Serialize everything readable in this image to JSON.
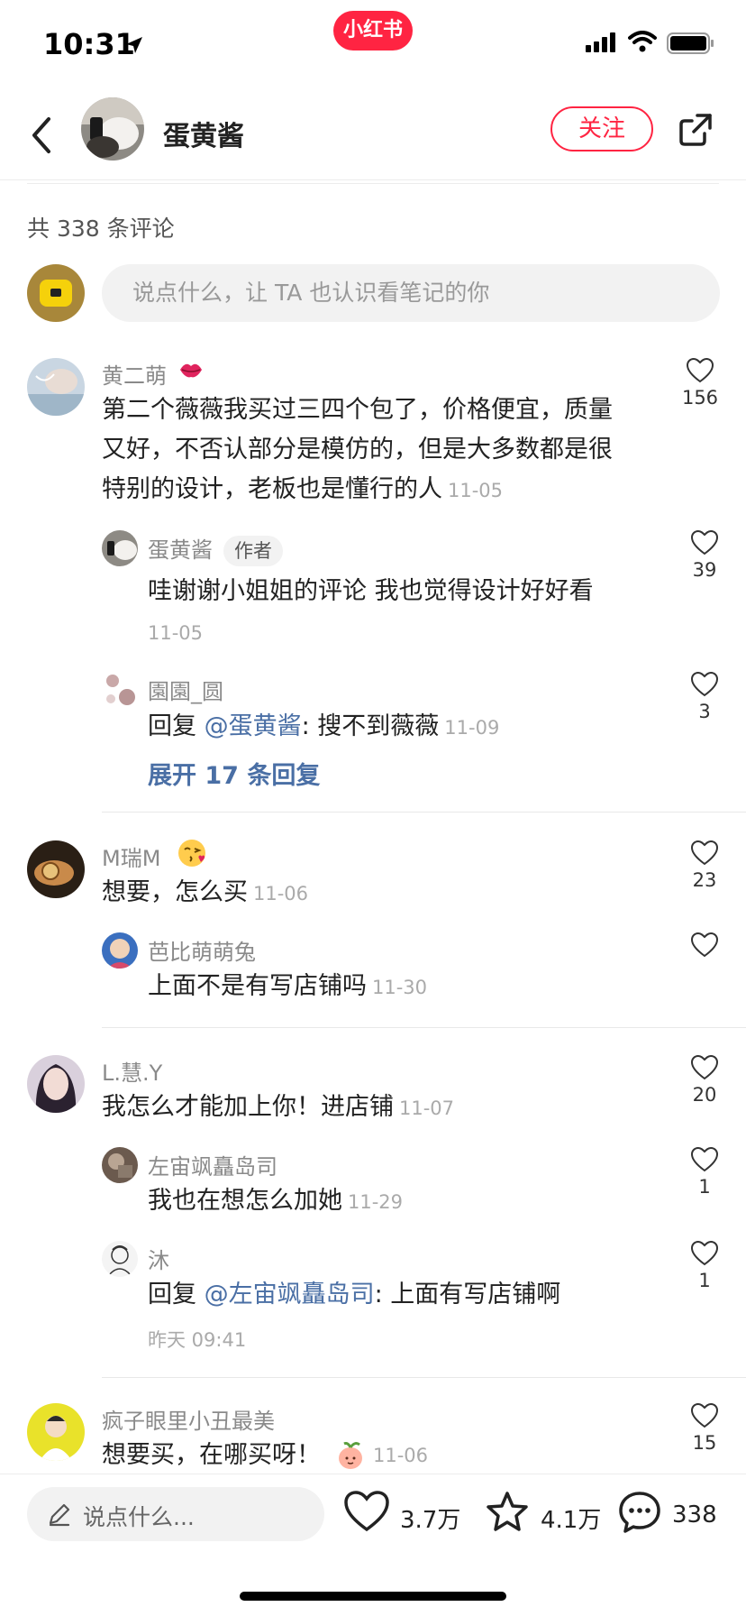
{
  "status_bar": {
    "time": "10:31",
    "app_badge": "小红书"
  },
  "header": {
    "author_name": "蛋黄酱",
    "follow_label": "关注"
  },
  "comments_summary": {
    "total": "共 338 条评论"
  },
  "input": {
    "placeholder": "说点什么，让 TA 也认识看笔记的你"
  },
  "comments": [
    {
      "user": "黄二萌",
      "text_lines": [
        "第二个薇薇我买过三四个包了，价格便宜，质量",
        "又好，不否认部分是模仿的，但是大多数都是很",
        "特别的设计，老板也是懂行的人"
      ],
      "date": "11-05",
      "likes": "156",
      "replies": [
        {
          "user": "蛋黄酱",
          "tag": "作者",
          "text": "哇谢谢小姐姐的评论 我也觉得设计好好看",
          "date": "11-05",
          "likes": "39"
        },
        {
          "user": "園園_圆",
          "prefix": "回复 ",
          "mention": "@蛋黄酱",
          "text": ": 搜不到薇薇",
          "date": "11-09",
          "likes": "3"
        }
      ],
      "expand_label": "展开 17 条回复"
    },
    {
      "user": "M瑞M",
      "text": "想要，怎么买",
      "date": "11-06",
      "likes": "23",
      "replies": [
        {
          "user": "芭比萌萌兔",
          "text": "上面不是有写店铺吗",
          "date": "11-30",
          "likes": ""
        }
      ]
    },
    {
      "user": "L.慧.Y",
      "text": "我怎么才能加上你！进店铺",
      "date": "11-07",
      "likes": "20",
      "replies": [
        {
          "user": "左宙飒矗岛司",
          "text": "我也在想怎么加她",
          "date": "11-29",
          "likes": "1"
        },
        {
          "user": "沐",
          "prefix": "回复 ",
          "mention": "@左宙飒矗岛司",
          "text": ": 上面有写店铺啊",
          "date": "昨天 09:41",
          "likes": "1"
        }
      ]
    },
    {
      "user": "疯子眼里小丑最美",
      "text": "想要买，在哪买呀！",
      "date": "11-06",
      "likes": "15"
    }
  ],
  "bottom_bar": {
    "input_placeholder": "说点什么...",
    "likes": "3.7万",
    "collects": "4.1万",
    "comments": "338"
  }
}
